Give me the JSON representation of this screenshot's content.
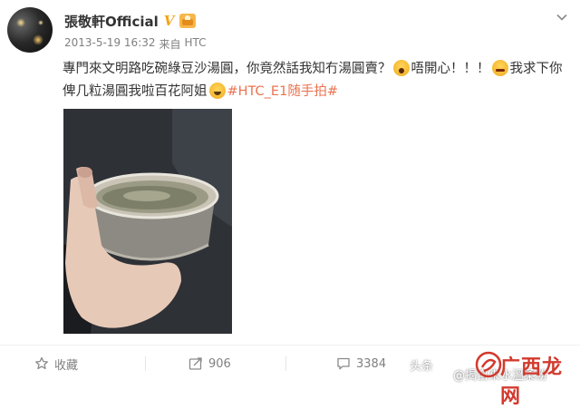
{
  "post": {
    "author": "張敬軒Official",
    "verified_icon": "V",
    "timestamp": "2013-5-19 16:32",
    "source_prefix": "来自",
    "source": "HTC",
    "text_part1": "專門來文明路吃碗綠豆沙湯圓，你竟然話我知冇湯圓賣？",
    "text_part2": "唔開心！！！",
    "text_part3": "我求下你俾几粒湯圓我啦百花阿姐",
    "topic": "#HTC_E1随手拍#"
  },
  "actions": {
    "favorite_label": "收藏",
    "repost_count": "906",
    "comment_count": "3384"
  },
  "watermark": {
    "left_text": "头条",
    "handle": "@揭自來水溫柔粉",
    "site": "广西龙网"
  },
  "icons": {
    "menu": "chevron-down-icon",
    "favorite": "star-icon",
    "repost": "share-icon",
    "comment": "comment-icon",
    "like": "thumbs-up-icon"
  },
  "colors": {
    "topic": "#eb7350",
    "verified": "#f3a417",
    "meta": "#808080"
  }
}
